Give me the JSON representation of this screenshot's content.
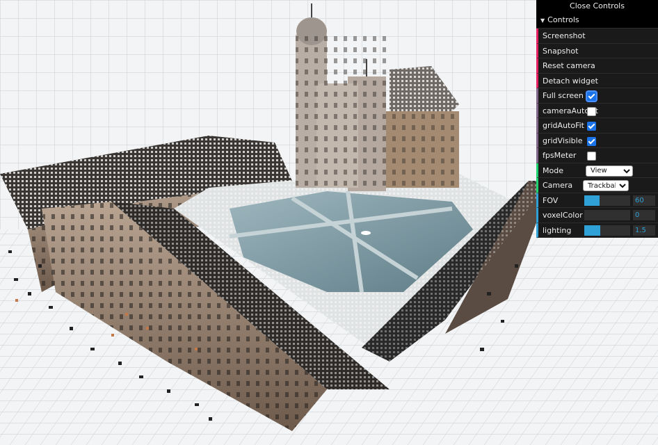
{
  "gui": {
    "close_label": "Close Controls",
    "folder_title": "Controls",
    "buttons": {
      "screenshot": "Screenshot",
      "snapshot": "Snapshot",
      "reset_camera": "Reset camera",
      "detach_widget": "Detach widget"
    },
    "toggles": [
      {
        "label": "Full screen",
        "checked": true
      },
      {
        "label": "cameraAutoFit",
        "checked": false
      },
      {
        "label": "gridAutoFit",
        "checked": true
      },
      {
        "label": "gridVisible",
        "checked": true
      },
      {
        "label": "fpsMeter",
        "checked": false
      }
    ],
    "mode": {
      "label": "Mode",
      "value": "View"
    },
    "camera": {
      "label": "Camera",
      "value": "Trackball"
    },
    "fov": {
      "label": "FOV",
      "value": "60",
      "fraction": 0.33
    },
    "voxel_color": {
      "label": "voxelColor",
      "value": "0",
      "fraction": 0.0
    },
    "lighting": {
      "label": "lighting",
      "value": "1.5",
      "fraction": 0.35
    }
  },
  "colors": {
    "panel_bg": "#1a1a1a",
    "function_accent": "#e61d5f",
    "boolean_accent": "#806787",
    "option_accent": "#1ed36f",
    "number_accent": "#2fa1d6"
  }
}
